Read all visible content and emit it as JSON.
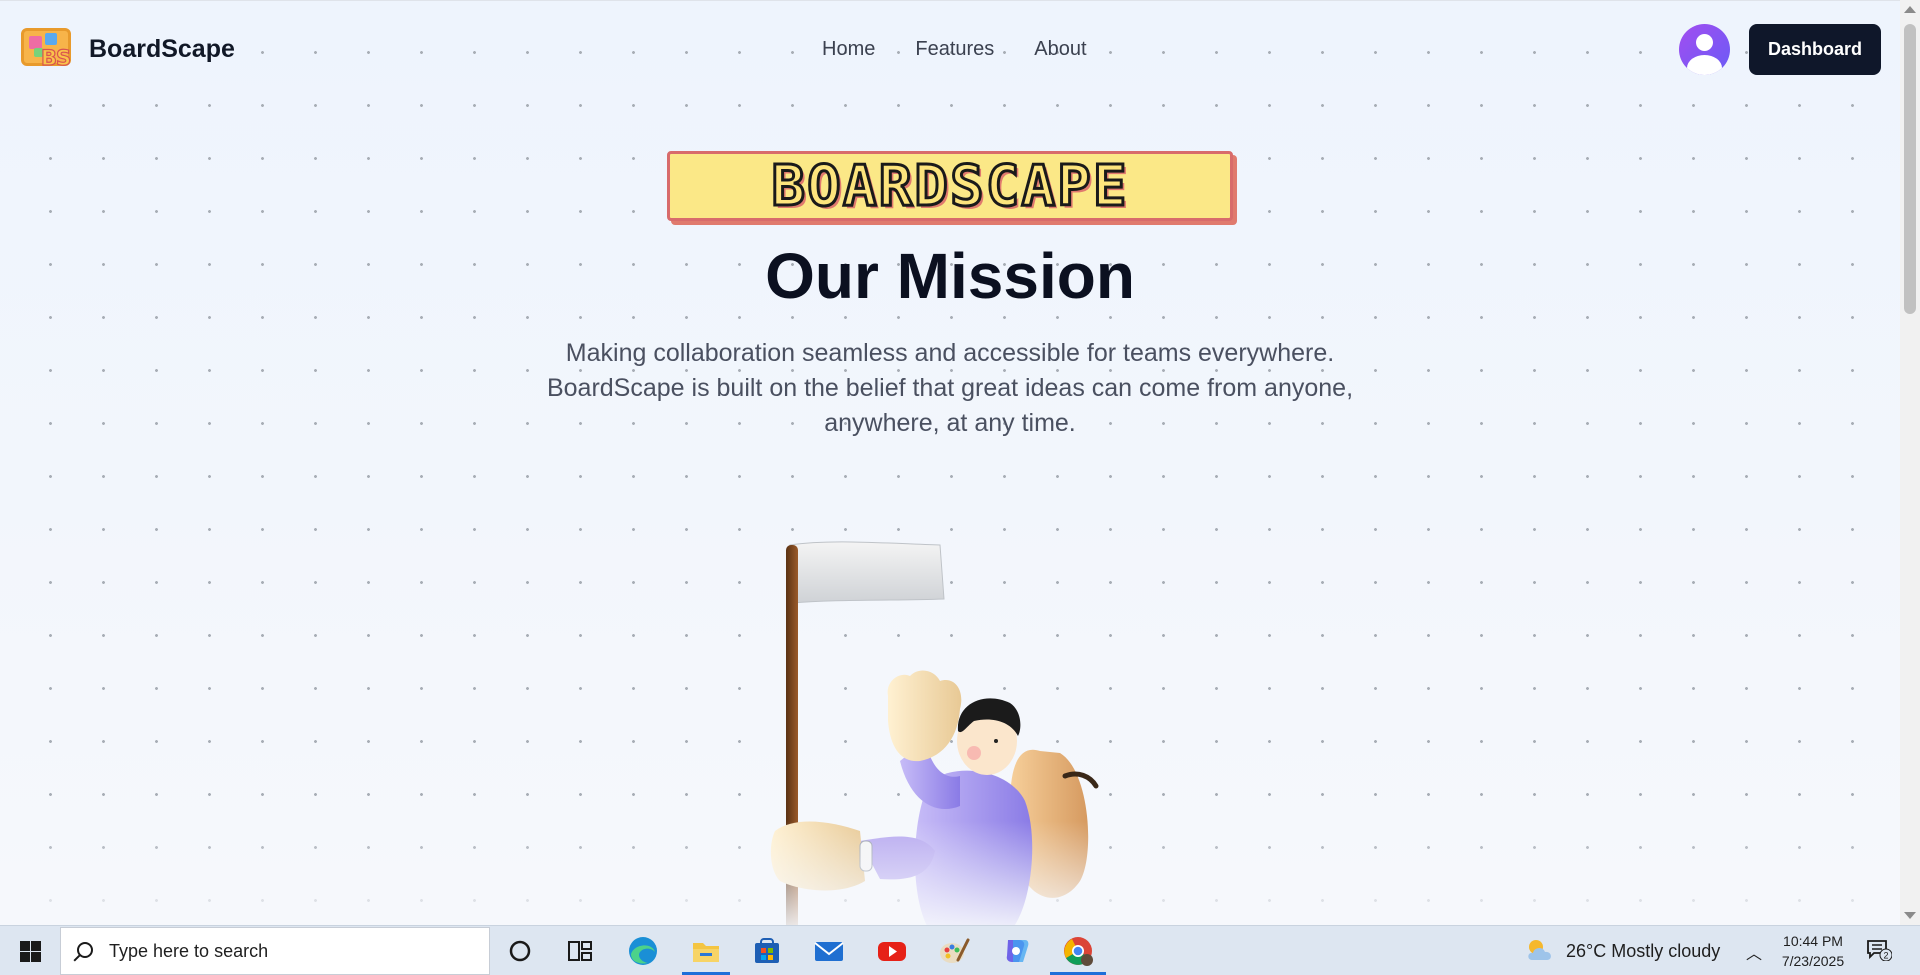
{
  "header": {
    "brand_name": "BoardScape",
    "logo_text": "BS",
    "nav": [
      "Home",
      "Features",
      "About"
    ],
    "dashboard_label": "Dashboard"
  },
  "hero": {
    "pixel_title": "BOARDSCAPE",
    "mission_title": "Our Mission",
    "mission_text": "Making collaboration seamless and accessible for teams everywhere. BoardScape is built on the belief that great ideas can come from anyone, anywhere, at any time."
  },
  "taskbar": {
    "search_placeholder": "Type here to search",
    "apps": [
      "cortana-icon",
      "task-view-icon",
      "edge-icon",
      "file-explorer-icon",
      "store-icon",
      "mail-icon",
      "youtube-icon",
      "paint-icon",
      "copilot-icon",
      "chrome-icon"
    ],
    "weather": "26°C  Mostly cloudy",
    "time": "10:44 PM",
    "date": "7/23/2025",
    "notification_count": "2"
  },
  "colors": {
    "primary_button": "#0f172a",
    "avatar_gradient_start": "#a24df0",
    "avatar_gradient_end": "#6a5cf6",
    "pixel_title_fill": "#fde47d",
    "pixel_title_shadow": "#e07a6e"
  }
}
